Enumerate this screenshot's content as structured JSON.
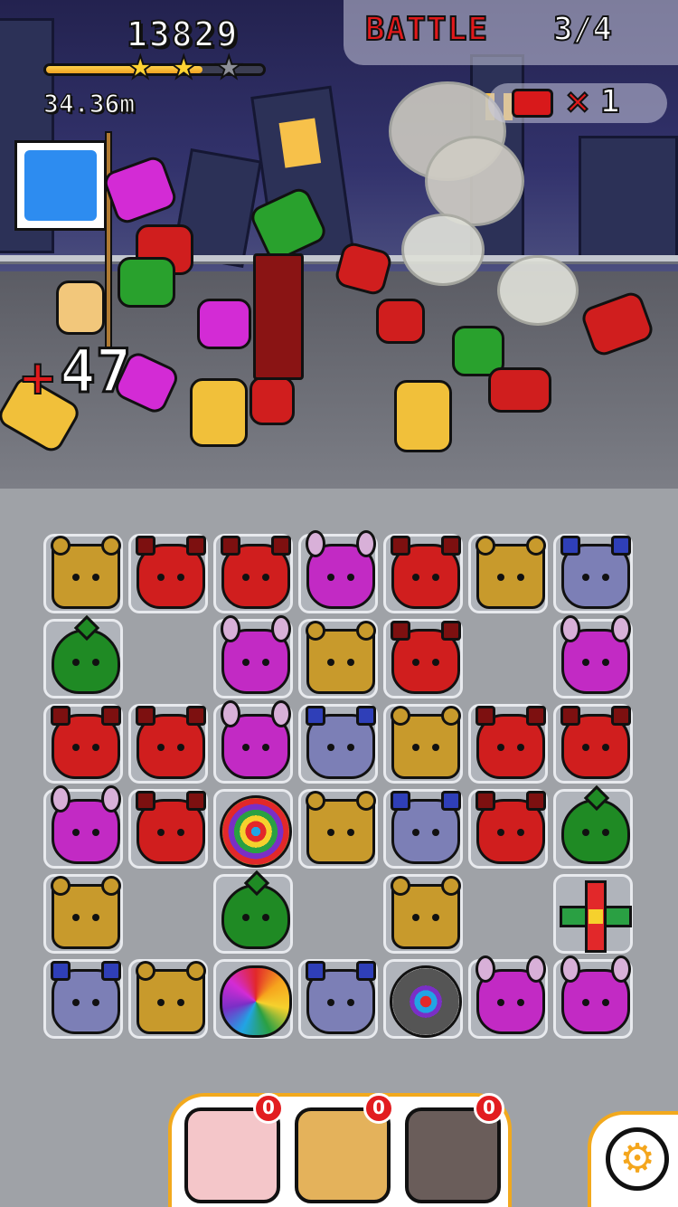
{
  "hud": {
    "score": "13829",
    "progress_fraction": 0.72,
    "stars_earned": 2,
    "stars_total": 3,
    "distance": "34.36m",
    "battle_label": "BATTLE",
    "battle_count": "3/4",
    "ticket_multiplier": "×",
    "ticket_count": "1"
  },
  "scene": {
    "heal_sign": "+",
    "heal_amount": "47"
  },
  "board": {
    "rows": [
      [
        "bear",
        "dog",
        "dog",
        "bunny",
        "dog",
        "bear",
        "cat"
      ],
      [
        "slime",
        "",
        "bunny",
        "bear",
        "dog",
        "",
        "bunny"
      ],
      [
        "dog",
        "dog",
        "bunny",
        "cat",
        "bear",
        "dog",
        "dog"
      ],
      [
        "bunny",
        "dog",
        "bomb",
        "bear",
        "cat",
        "dog",
        "slime"
      ],
      [
        "bear",
        "",
        "slime",
        "",
        "bear",
        "",
        "cross"
      ],
      [
        "cat",
        "bear",
        "flower",
        "cat",
        "sawbomb",
        "bunny",
        "bunny"
      ]
    ]
  },
  "heroes": [
    {
      "name": "hero-flower-girl",
      "badge": "0",
      "color": "#f4c6c9"
    },
    {
      "name": "hero-grin-boy",
      "badge": "0",
      "color": "#e4b25b"
    },
    {
      "name": "hero-curly-villain",
      "badge": "0",
      "color": "#6a5d5a"
    }
  ],
  "colors": {
    "accent": "#f2a91d",
    "battle_red": "#e0191b",
    "badge_red": "#e21d20"
  },
  "icons": {
    "settings": "gear-icon",
    "ticket": "ticket-icon",
    "star": "star-icon"
  }
}
